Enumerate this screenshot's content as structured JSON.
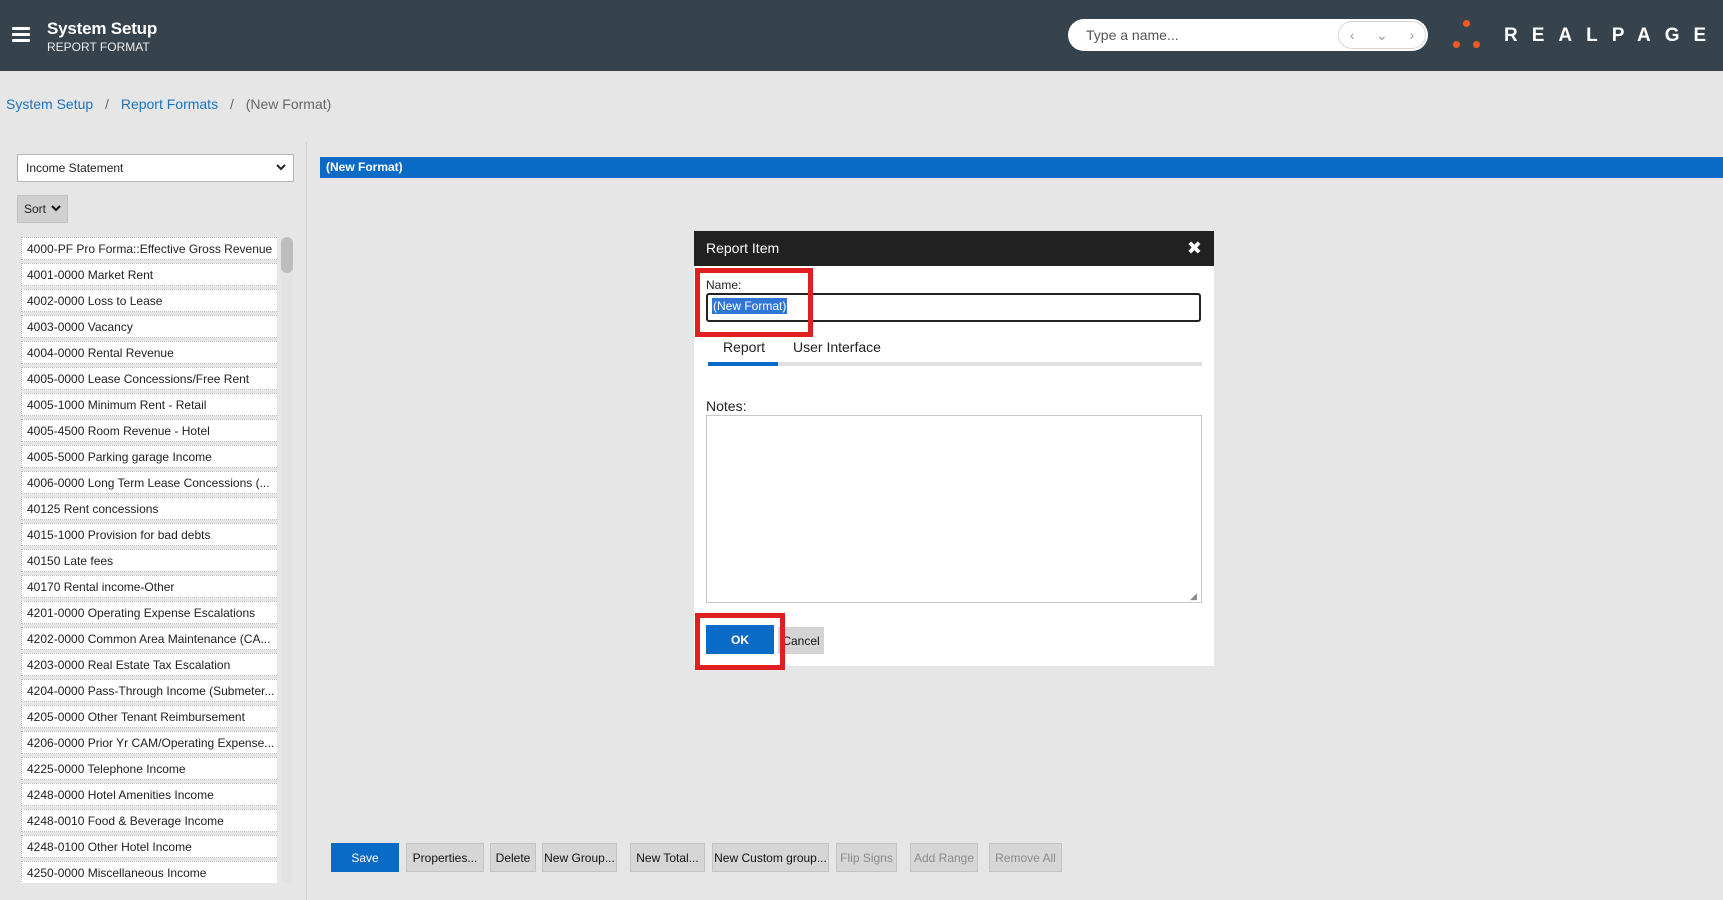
{
  "header": {
    "title": "System Setup",
    "subtitle": "REPORT FORMAT",
    "search_placeholder": "Type a name...",
    "nav_prev": "‹",
    "nav_down": "⌄",
    "nav_next": "›",
    "logo_text": "REALPAGE",
    "brand_color": "#f15a24"
  },
  "breadcrumb": {
    "items": [
      "System Setup",
      "Report Formats"
    ],
    "separator": "/",
    "current": "(New Format)"
  },
  "left_panel": {
    "format_select": "Income Statement",
    "sort_label": "Sort",
    "accounts": [
      "4000-PF Pro Forma::Effective Gross Revenue",
      "4001-0000 Market Rent",
      "4002-0000 Loss to Lease",
      "4003-0000 Vacancy",
      "4004-0000 Rental Revenue",
      "4005-0000 Lease Concessions/Free Rent",
      "4005-1000 Minimum Rent - Retail",
      "4005-4500 Room Revenue - Hotel",
      "4005-5000 Parking garage Income",
      "4006-0000 Long Term Lease Concessions (...",
      "40125 Rent concessions",
      "4015-1000 Provision for bad debts",
      "40150 Late fees",
      "40170 Rental income-Other",
      "4201-0000 Operating Expense Escalations",
      "4202-0000 Common Area Maintenance (CA...",
      "4203-0000 Real Estate Tax Escalation",
      "4204-0000 Pass-Through Income (Submeter...",
      "4205-0000 Other Tenant Reimbursement",
      "4206-0000 Prior Yr CAM/Operating Expense...",
      "4225-0000 Telephone Income",
      "4248-0000 Hotel Amenities Income",
      "4248-0010 Food & Beverage Income",
      "4248-0100 Other Hotel Income",
      "4250-0000 Miscellaneous Income"
    ]
  },
  "main": {
    "format_title": "(New Format)"
  },
  "toolbar": {
    "save": "Save",
    "properties": "Properties...",
    "delete": "Delete",
    "new_group": "New Group...",
    "new_total": "New Total...",
    "new_custom_group": "New Custom group...",
    "flip_signs": "Flip Signs",
    "add_range": "Add Range",
    "remove_all": "Remove All"
  },
  "dialog": {
    "title": "Report Item",
    "close": "✖",
    "name_label": "Name:",
    "name_value": "(New Format)",
    "tabs": [
      "Report",
      "User Interface"
    ],
    "notes_label": "Notes:",
    "notes_value": "",
    "ok_label": "OK",
    "cancel_label": "Cancel"
  }
}
